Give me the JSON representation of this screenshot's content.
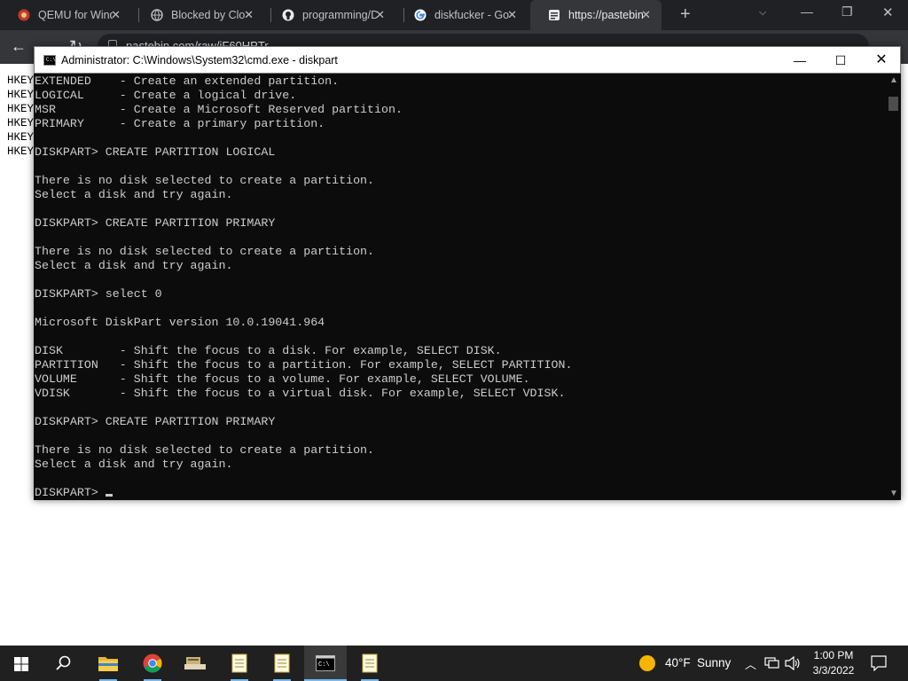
{
  "browser": {
    "tabs": [
      {
        "title": "QEMU for Wind",
        "icon": "qemu-icon"
      },
      {
        "title": "Blocked by Clo",
        "icon": "globe-icon"
      },
      {
        "title": "programming/D",
        "icon": "github-icon"
      },
      {
        "title": "diskfucker - Go",
        "icon": "google-icon"
      },
      {
        "title": "https://pastebin",
        "icon": "pastebin-icon"
      }
    ],
    "active_tab_index": 4,
    "url": "pastebin.com/raw/iF60HPTr",
    "page_lines": [
      "HKEY",
      "HKEY",
      "HKEY",
      "HKEY",
      "HKEY",
      "HKEY"
    ]
  },
  "cmd": {
    "title": "Administrator: C:\\Windows\\System32\\cmd.exe - diskpart",
    "icon_glyph": "C:\\",
    "lines": [
      "EXTENDED    - Create an extended partition.",
      "LOGICAL     - Create a logical drive.",
      "MSR         - Create a Microsoft Reserved partition.",
      "PRIMARY     - Create a primary partition.",
      "",
      "DISKPART> CREATE PARTITION LOGICAL",
      "",
      "There is no disk selected to create a partition.",
      "Select a disk and try again.",
      "",
      "DISKPART> CREATE PARTITION PRIMARY",
      "",
      "There is no disk selected to create a partition.",
      "Select a disk and try again.",
      "",
      "DISKPART> select 0",
      "",
      "Microsoft DiskPart version 10.0.19041.964",
      "",
      "DISK        - Shift the focus to a disk. For example, SELECT DISK.",
      "PARTITION   - Shift the focus to a partition. For example, SELECT PARTITION.",
      "VOLUME      - Shift the focus to a volume. For example, SELECT VOLUME.",
      "VDISK       - Shift the focus to a virtual disk. For example, SELECT VDISK.",
      "",
      "DISKPART> CREATE PARTITION PRIMARY",
      "",
      "There is no disk selected to create a partition.",
      "Select a disk and try again.",
      "",
      "DISKPART> "
    ]
  },
  "taskbar": {
    "apps": [
      "file-explorer-icon",
      "chrome-icon",
      "app-icon",
      "notepad-icon",
      "notepad-icon",
      "cmd-icon",
      "notepad-icon"
    ],
    "active_app_index": 5,
    "weather_temp": "40°F",
    "weather_desc": "Sunny",
    "time": "1:00 PM",
    "date": "3/3/2022"
  },
  "colors": {
    "console_bg": "#0c0c0c",
    "console_text": "#cccccc",
    "taskbar_bg": "#202020",
    "chrome_tabstrip": "#202124",
    "chrome_active": "#35363a"
  }
}
